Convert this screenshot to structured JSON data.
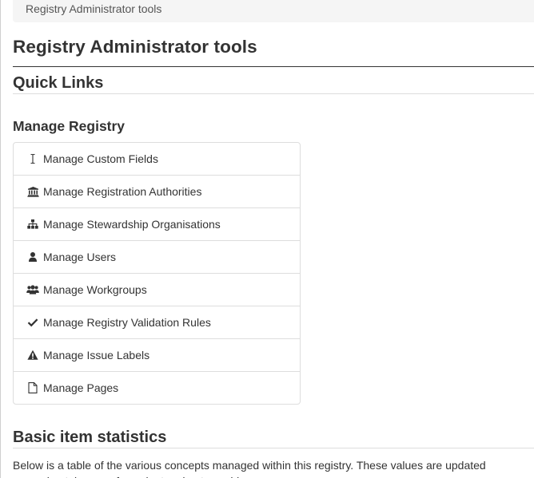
{
  "breadcrumb": {
    "current": "Registry Administrator tools"
  },
  "page": {
    "title": "Registry Administrator tools",
    "quick_links_heading": "Quick Links",
    "manage_registry_heading": "Manage Registry"
  },
  "manage_links": [
    {
      "label": "Manage Custom Fields",
      "icon": "i-cursor-icon"
    },
    {
      "label": "Manage Registration Authorities",
      "icon": "institution-icon"
    },
    {
      "label": "Manage Stewardship Organisations",
      "icon": "sitemap-icon"
    },
    {
      "label": "Manage Users",
      "icon": "user-icon"
    },
    {
      "label": "Manage Workgroups",
      "icon": "users-icon"
    },
    {
      "label": "Manage Registry Validation Rules",
      "icon": "check-icon"
    },
    {
      "label": "Manage Issue Labels",
      "icon": "warning-icon"
    },
    {
      "label": "Manage Pages",
      "icon": "file-icon"
    }
  ],
  "stats": {
    "heading": "Basic item statistics",
    "description": "Below is a table of the various concepts managed within this registry. These values are updated approximately every few minutes due to caching."
  },
  "colors": {
    "text": "#333333",
    "border": "#dddddd",
    "breadcrumb_bg": "#f5f5f5"
  }
}
